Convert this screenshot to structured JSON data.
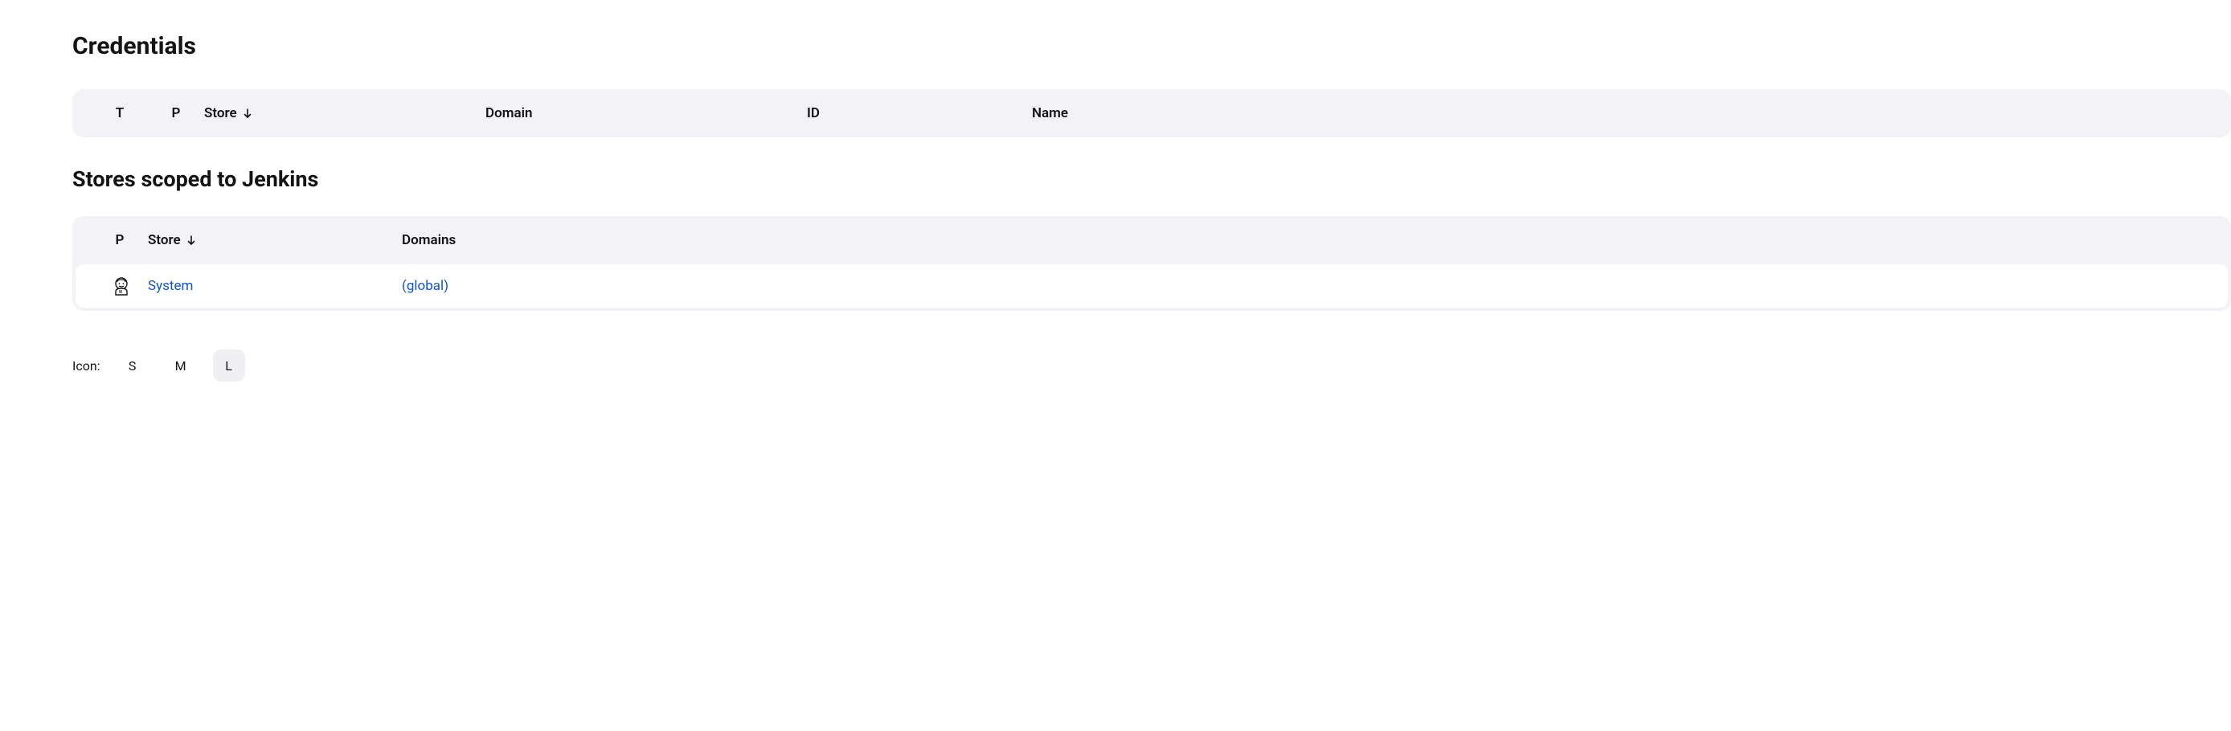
{
  "page": {
    "title": "Credentials"
  },
  "credentials_table": {
    "headers": {
      "t": "T",
      "p": "P",
      "store": "Store",
      "domain": "Domain",
      "id": "ID",
      "name": "Name"
    }
  },
  "stores_section": {
    "title": "Stores scoped to Jenkins",
    "headers": {
      "p": "P",
      "store": "Store",
      "domains": "Domains"
    },
    "rows": [
      {
        "icon": "jenkins-icon",
        "store": "System",
        "domains": "(global)"
      }
    ]
  },
  "icon_size": {
    "label": "Icon:",
    "options": [
      "S",
      "M",
      "L"
    ],
    "selected": "L"
  }
}
